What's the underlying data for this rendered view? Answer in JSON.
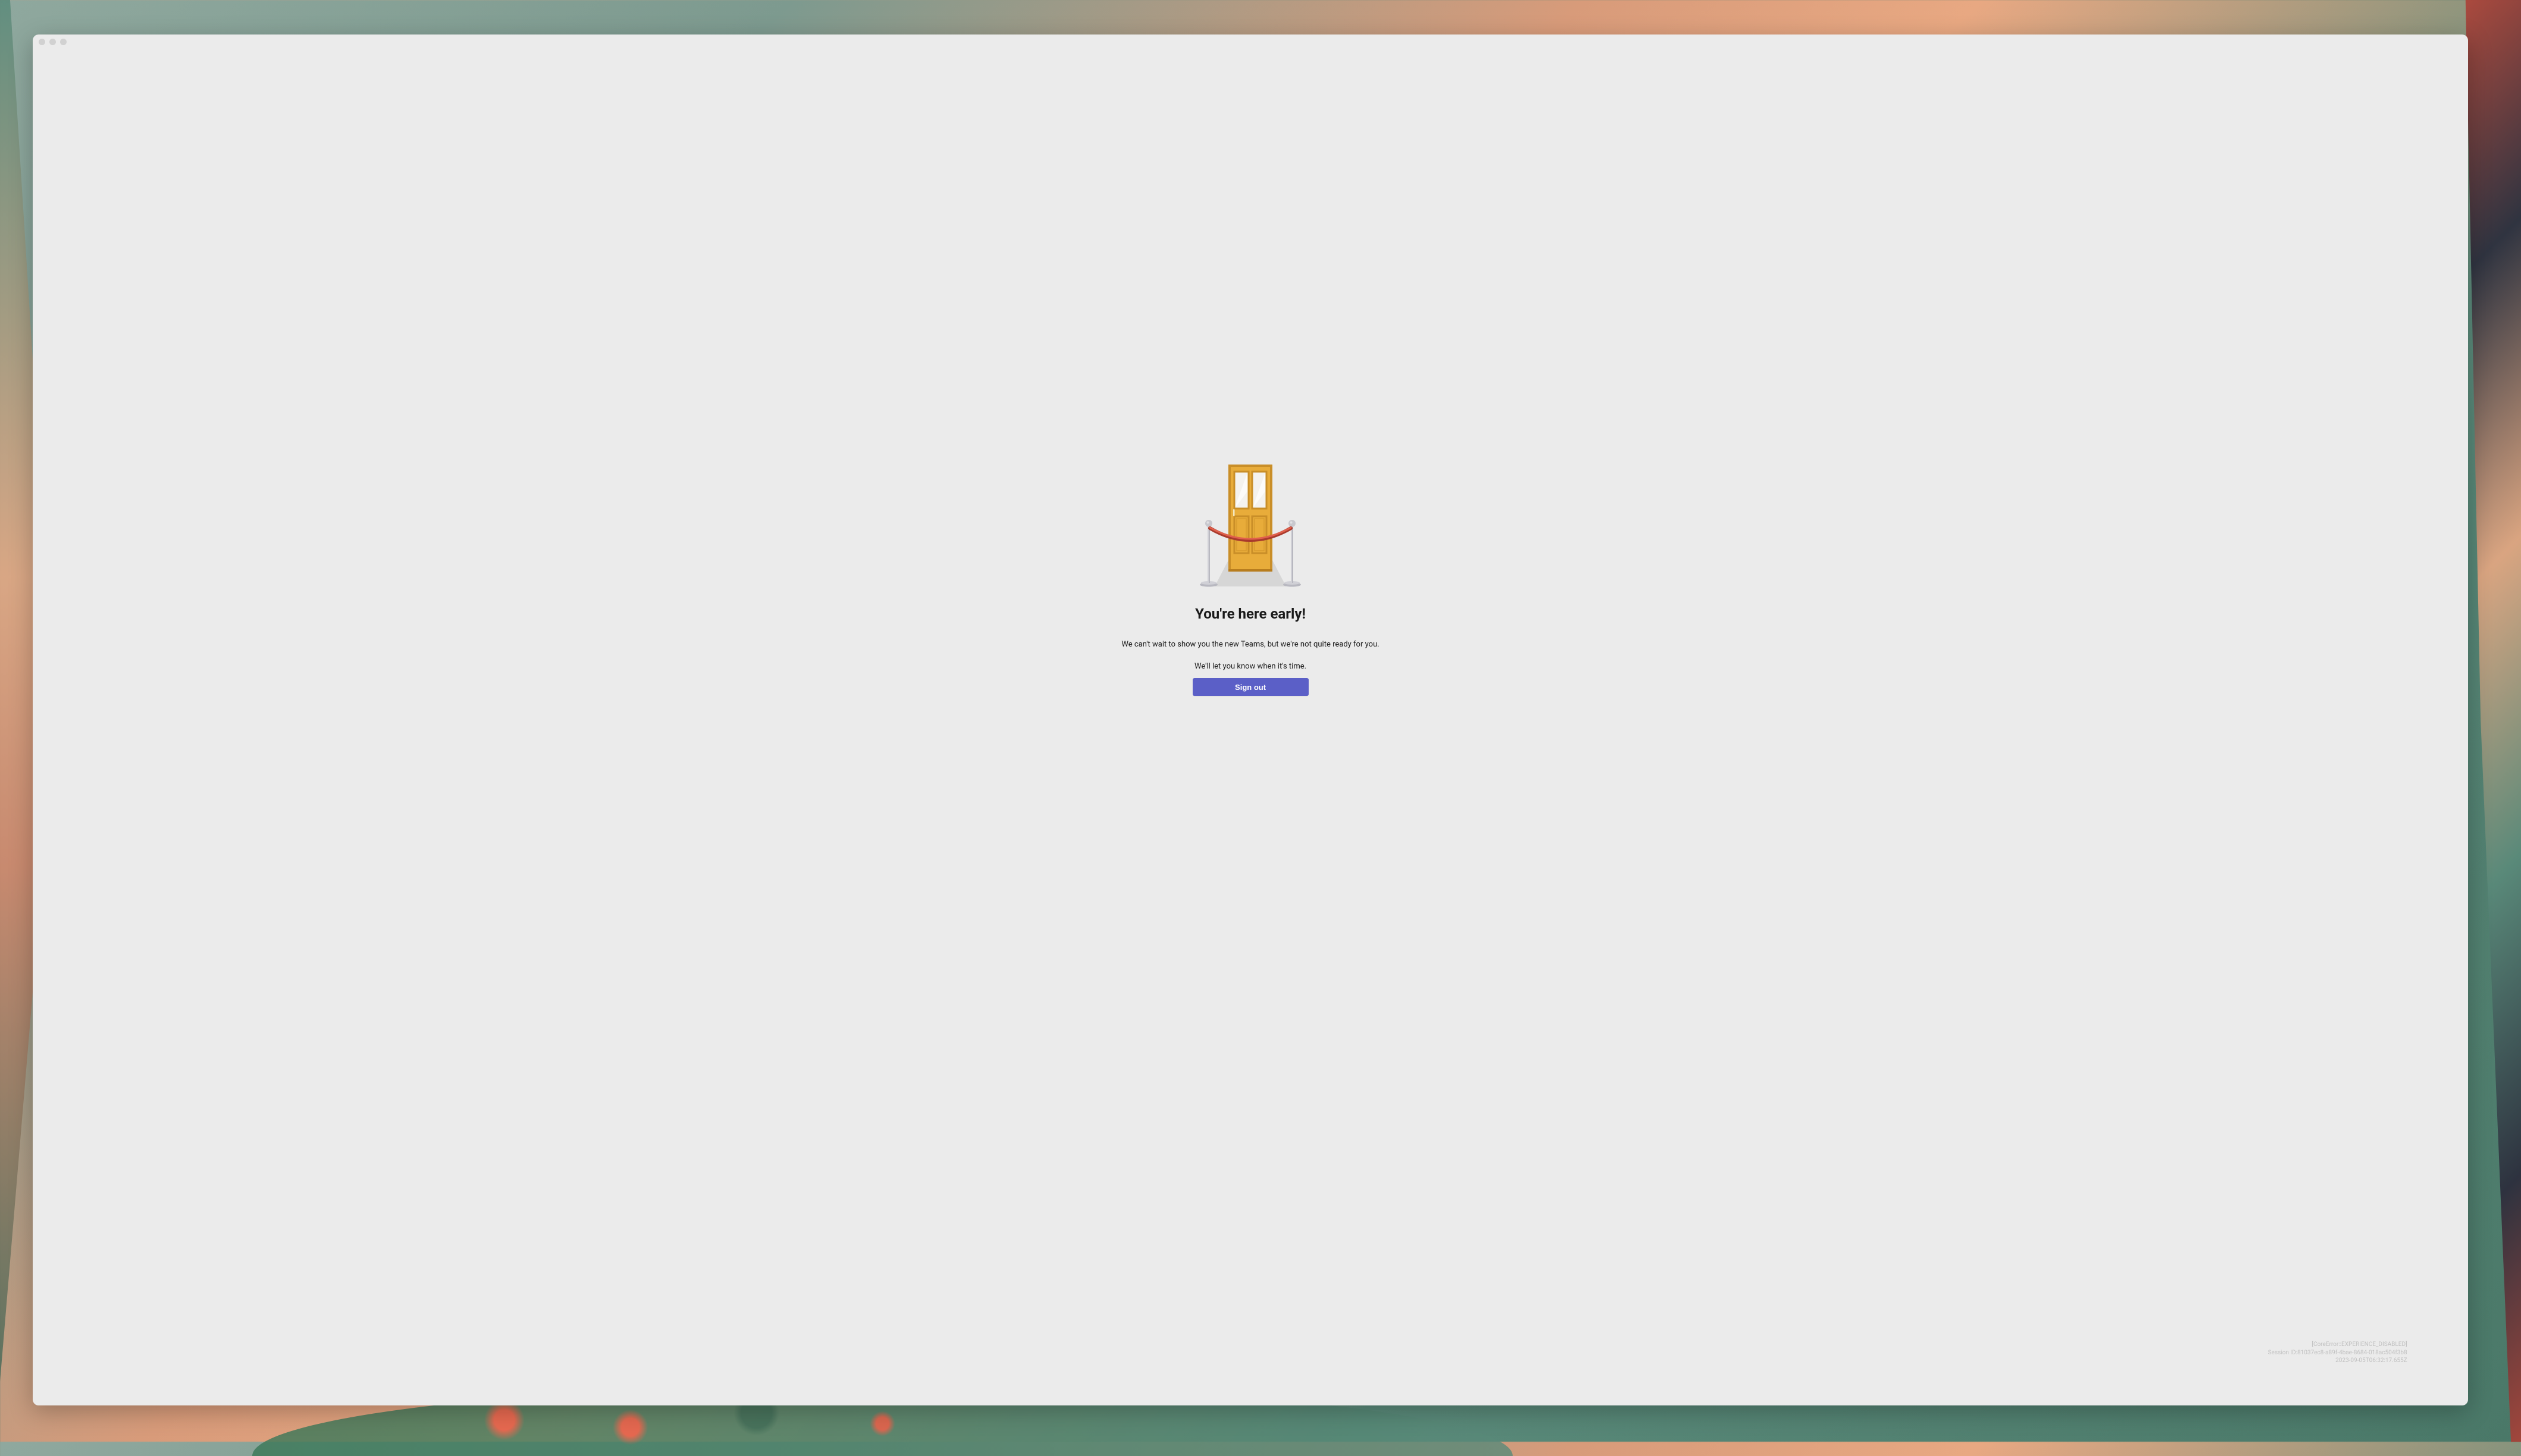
{
  "content": {
    "heading": "You're here early!",
    "line1": "We can't wait to show you the new Teams, but we're not quite ready for you.",
    "line2": "We'll let you know when it's time.",
    "signout_label": "Sign out"
  },
  "diagnostics": {
    "error": "[CoreError::EXPERIENCE_DISABLED]",
    "session": "Session ID:81037ec8-a89f-4bae-8684-018ac504f3b8",
    "timestamp": "2023-09-05T06:32:17.655Z"
  },
  "illustration": {
    "name": "door-velvet-rope",
    "colors": {
      "door": "#e8ac3a",
      "door_edge": "#c98e28",
      "window": "#f4f2ee",
      "floor": "#d6d6d6",
      "stanchion": "#b8b8c0",
      "rope": "#c94b3a"
    }
  }
}
